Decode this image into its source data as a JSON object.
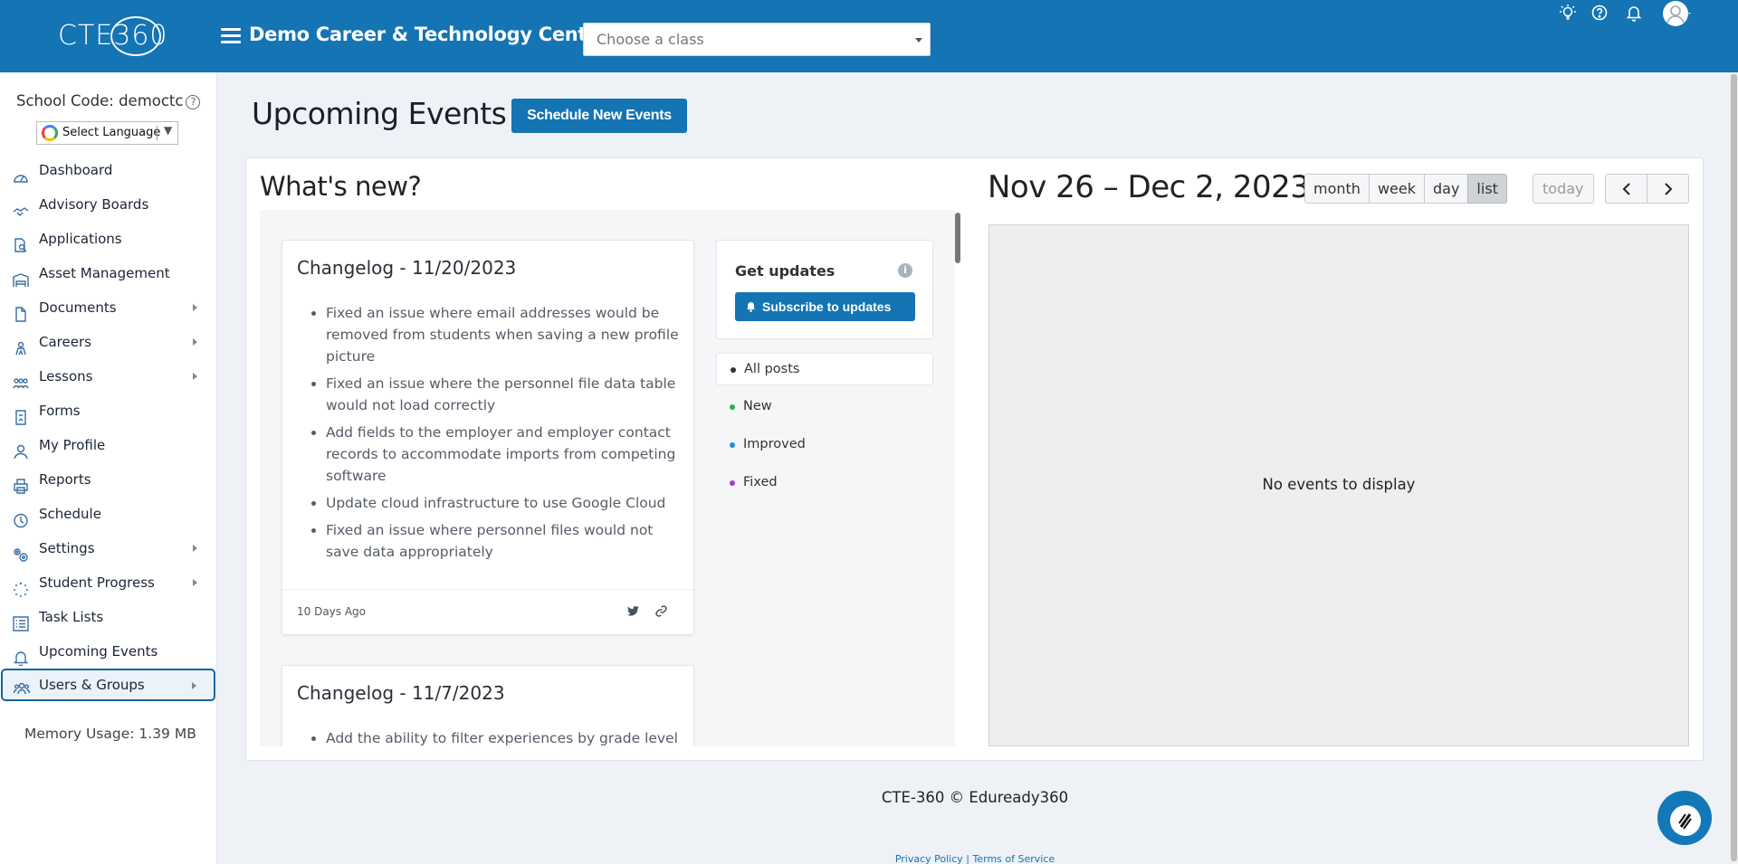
{
  "header": {
    "logo_text": "CTE360",
    "org_name": "Demo Career & Technology Center",
    "class_select": {
      "placeholder": "Choose a class"
    },
    "icons": [
      "lightbulb-icon",
      "help-icon",
      "bell-icon",
      "avatar"
    ]
  },
  "sidebar": {
    "school_code": "School Code: democtc",
    "language_select": "Select Language",
    "items": [
      {
        "label": "Dashboard",
        "icon": "dashboard-gauge-icon",
        "has_submenu": false
      },
      {
        "label": "Advisory Boards",
        "icon": "handshake-icon",
        "has_submenu": false
      },
      {
        "label": "Applications",
        "icon": "document-search-icon",
        "has_submenu": false
      },
      {
        "label": "Asset Management",
        "icon": "warehouse-icon",
        "has_submenu": false
      },
      {
        "label": "Documents",
        "icon": "document-icon",
        "has_submenu": true
      },
      {
        "label": "Careers",
        "icon": "career-icon",
        "has_submenu": true
      },
      {
        "label": "Lessons",
        "icon": "lessons-icon",
        "has_submenu": true
      },
      {
        "label": "Forms",
        "icon": "form-icon",
        "has_submenu": false
      },
      {
        "label": "My Profile",
        "icon": "user-icon",
        "has_submenu": false
      },
      {
        "label": "Reports",
        "icon": "printer-icon",
        "has_submenu": false
      },
      {
        "label": "Schedule",
        "icon": "clock-icon",
        "has_submenu": false
      },
      {
        "label": "Settings",
        "icon": "gears-icon",
        "has_submenu": true
      },
      {
        "label": "Student Progress",
        "icon": "progress-spinner-icon",
        "has_submenu": true
      },
      {
        "label": "Task Lists",
        "icon": "list-icon",
        "has_submenu": false
      },
      {
        "label": "Upcoming Events",
        "icon": "bell-icon",
        "has_submenu": false
      },
      {
        "label": "Users & Groups",
        "icon": "users-icon",
        "has_submenu": true,
        "active": true
      }
    ],
    "memory_usage": "Memory Usage: 1.39 MB"
  },
  "main": {
    "title": "Upcoming Events",
    "schedule_button": "Schedule New Events",
    "whats_new": {
      "heading": "What's new?",
      "posts": [
        {
          "title": "Changelog - 11/20/2023",
          "items": [
            "Fixed an issue where email addresses would be removed from students when saving a new profile picture",
            "Fixed an issue where the personnel file data table would not load correctly",
            "Add fields to the employer and employer contact records to accommodate imports from competing software",
            "Update cloud infrastructure to use Google Cloud",
            "Fixed an issue where personnel files would not save data appropriately"
          ],
          "date": "10 Days Ago"
        },
        {
          "title": "Changelog - 11/7/2023",
          "items": [
            "Add the ability to filter experiences by grade level"
          ]
        }
      ],
      "updates": {
        "title": "Get updates",
        "subscribe_button": "Subscribe to updates"
      },
      "filters": [
        {
          "label": "All posts",
          "color": "#333333",
          "selected": true
        },
        {
          "label": "New",
          "color": "#22b14c",
          "selected": false
        },
        {
          "label": "Improved",
          "color": "#1a8fd6",
          "selected": false
        },
        {
          "label": "Fixed",
          "color": "#a23bd6",
          "selected": false
        }
      ]
    },
    "calendar": {
      "range_title": "Nov 26 – Dec 2, 2023",
      "views": [
        {
          "label": "month",
          "active": false
        },
        {
          "label": "week",
          "active": false
        },
        {
          "label": "day",
          "active": false
        },
        {
          "label": "list",
          "active": true
        }
      ],
      "today_button": "today",
      "empty_text": "No events to display"
    }
  },
  "footer": {
    "copyright": "CTE-360 © Eduready360",
    "privacy": "Privacy Policy",
    "separator": "|",
    "terms": "Terms of Service"
  },
  "colors": {
    "brand": "#1474b4",
    "sidebar_active_border": "#1565a0"
  }
}
